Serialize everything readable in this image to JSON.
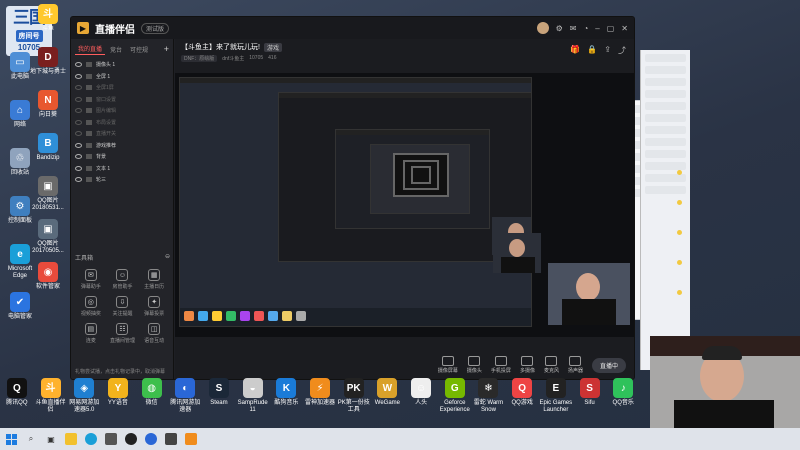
{
  "overlay": {
    "big": "三国",
    "label": "房间号",
    "number": "10705"
  },
  "desktop_icons_left": [
    {
      "label": "此电脑",
      "color": "#4f8fd6",
      "glyph": "▭"
    },
    {
      "label": "网络",
      "color": "#3a7bd5",
      "glyph": "⌂"
    },
    {
      "label": "回收站",
      "color": "#8fa3bd",
      "glyph": "♲"
    },
    {
      "label": "控制面板",
      "color": "#3f7fbf",
      "glyph": "⚙"
    },
    {
      "label": "Microsoft Edge",
      "color": "#1a9fd8",
      "glyph": "e"
    },
    {
      "label": "电脑管家",
      "color": "#2b74e0",
      "glyph": "✔"
    }
  ],
  "desktop_icons_left2": [
    {
      "label": "斗鱼",
      "color": "#ffc82d",
      "glyph": "斗"
    },
    {
      "label": "地下城与勇士",
      "color": "#7a1f1f",
      "glyph": "D"
    },
    {
      "label": "向日葵",
      "color": "#e8572f",
      "glyph": "N"
    },
    {
      "label": "Bandizip",
      "color": "#2f8fd8",
      "glyph": "B"
    },
    {
      "label": "QQ图片20180531...",
      "color": "#6a6a6a",
      "glyph": "▣"
    },
    {
      "label": "QQ图片20170505...",
      "color": "#5a6b7c",
      "glyph": "▣"
    },
    {
      "label": "软件管家",
      "color": "#e94b3c",
      "glyph": "◉"
    }
  ],
  "desktop_icons_bottom": [
    {
      "label": "腾讯QQ",
      "color": "#111",
      "glyph": "Q"
    },
    {
      "label": "斗鱼直播伴侣",
      "color": "#ffb22d",
      "glyph": "斗"
    },
    {
      "label": "网易网游加速器5.0",
      "color": "#1f7fd1",
      "glyph": "◈"
    },
    {
      "label": "YY语音",
      "color": "#f2b31c",
      "glyph": "Y"
    },
    {
      "label": "微信",
      "color": "#3dbf4c",
      "glyph": "◍"
    },
    {
      "label": "腾讯网游加速器",
      "color": "#2a67d6",
      "glyph": "◐"
    },
    {
      "label": "Steam",
      "color": "#1b2838",
      "glyph": "S"
    },
    {
      "label": "SampRude 11",
      "color": "#ccc",
      "glyph": "◒"
    },
    {
      "label": "酷狗音乐",
      "color": "#1a7bd8",
      "glyph": "K"
    },
    {
      "label": "雷神加速器",
      "color": "#f08c1c",
      "glyph": "⚡"
    },
    {
      "label": "PK第一份技工具",
      "color": "#222",
      "glyph": "PK"
    },
    {
      "label": "WeGame",
      "color": "#d9a12a",
      "glyph": "W"
    },
    {
      "label": "人头",
      "color": "#eee",
      "glyph": "☺"
    },
    {
      "label": "Geforce Experience",
      "color": "#76b900",
      "glyph": "G"
    },
    {
      "label": "雷蛇 Warm Snow",
      "color": "#2a2a2a",
      "glyph": "❄"
    },
    {
      "label": "QQ游戏",
      "color": "#e44",
      "glyph": "Q"
    },
    {
      "label": "Epic Games Launcher",
      "color": "#222",
      "glyph": "E"
    },
    {
      "label": "Sifu",
      "color": "#c33",
      "glyph": "S"
    },
    {
      "label": "QQ音乐",
      "color": "#2fc25b",
      "glyph": "♪"
    }
  ],
  "window": {
    "title": "直播伴侣",
    "badge": "测试版",
    "sidebar_tabs": [
      "我的直播",
      "竞台",
      "可控规"
    ],
    "scenes": [
      {
        "label": "摄像头 1",
        "dim": false
      },
      {
        "label": "全屏 1",
        "dim": false
      },
      {
        "label": "全屏1屏",
        "dim": true
      },
      {
        "label": "窗口设置",
        "dim": true
      },
      {
        "label": "图片编辑",
        "dim": true
      },
      {
        "label": "布局设置",
        "dim": true
      },
      {
        "label": "直播开关",
        "dim": true
      },
      {
        "label": "游戏推荐",
        "dim": false
      },
      {
        "label": "背景",
        "dim": false
      },
      {
        "label": "文本 1",
        "dim": false
      },
      {
        "label": "轮三",
        "dim": false
      }
    ],
    "tools_title": "工具箱",
    "tools": [
      {
        "label": "弹幕助手",
        "glyph": "✉"
      },
      {
        "label": "房管助手",
        "glyph": "☺"
      },
      {
        "label": "主播日历",
        "glyph": "▦"
      },
      {
        "label": "视频抽奖",
        "glyph": "◎"
      },
      {
        "label": "关注提醒",
        "glyph": "⇩"
      },
      {
        "label": "弹幕投票",
        "glyph": "✦"
      },
      {
        "label": "连麦",
        "glyph": "▤"
      },
      {
        "label": "直播间管理",
        "glyph": "☷"
      },
      {
        "label": "语音互动",
        "glyph": "◫"
      }
    ],
    "footer": "礼物尝试播，点击礼物记录中，取消弹幕",
    "stream_title": "【斗鱼主】来了就玩儿玩!",
    "stream_tag": "游戏",
    "stream_meta": [
      "DNF：原绘版",
      "dnf斗鱼主",
      "10705",
      "416"
    ],
    "bottom_buttons": [
      "摄像屏幕",
      "摄像头",
      "手机投屏",
      "多摄像",
      "麦克风",
      "扬声器"
    ],
    "live_button": "直播中"
  }
}
